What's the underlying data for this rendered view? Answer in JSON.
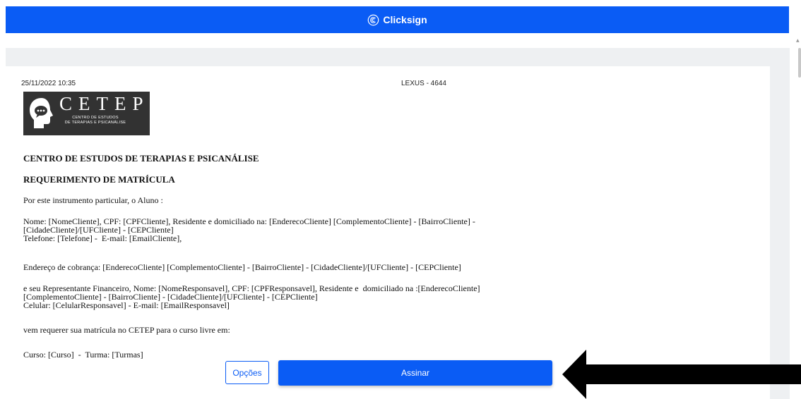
{
  "app": {
    "brand": "Clicksign"
  },
  "colors": {
    "accent": "#0a5cf5",
    "logo_bg": "#323232"
  },
  "document": {
    "timestamp": "25/11/2022 10:35",
    "doc_code": "LEXUS - 4644",
    "logo": {
      "name": "CETEP",
      "subtitle_line1": "CENTRO DE ESTUDOS",
      "subtitle_line2": "DE TERAPIAS E PSICANÁLISE"
    },
    "heading1": "CENTRO DE ESTUDOS DE TERAPIAS E PSICANÁLISE",
    "heading2": "REQUERIMENTO DE MATRÍCULA",
    "intro": "Por este instrumento particular, o Aluno :",
    "aluno_line1": "Nome: [NomeCliente], CPF: [CPFCliente], Residente e domiciliado na: [EnderecoCliente] [ComplementoCliente] - [BairroCliente] -",
    "aluno_line2": "[CidadeCliente]/[UFCliente] - [CEPCliente]",
    "aluno_line3": "Telefone: [Telefone] -  E-mail: [EmailCliente],",
    "cobranca": "Endereço de cobrança: [EnderecoCliente] [ComplementoCliente] - [BairroCliente] - [CidadeCliente]/[UFCliente] - [CEPCliente]",
    "resp_line1": "e seu Representante Financeiro, Nome: [NomeResponsavel], CPF: [CPFResponsavel], Residente e  domiciliado na :[EnderecoCliente]",
    "resp_line2": "[ComplementoCliente] - [BairroCliente] - [CidadeCliente]/[UFCliente] - [CEPCliente]",
    "resp_line3": "Celular: [CelularResponsavel] - E-mail: [EmailResponsavel]",
    "requerer": "vem requerer sua matrícula no CETEP para o curso livre em:",
    "curso": "Curso: [Curso]  -  Turma: [Turmas]"
  },
  "actions": {
    "options_label": "Opções",
    "sign_label": "Assinar"
  }
}
